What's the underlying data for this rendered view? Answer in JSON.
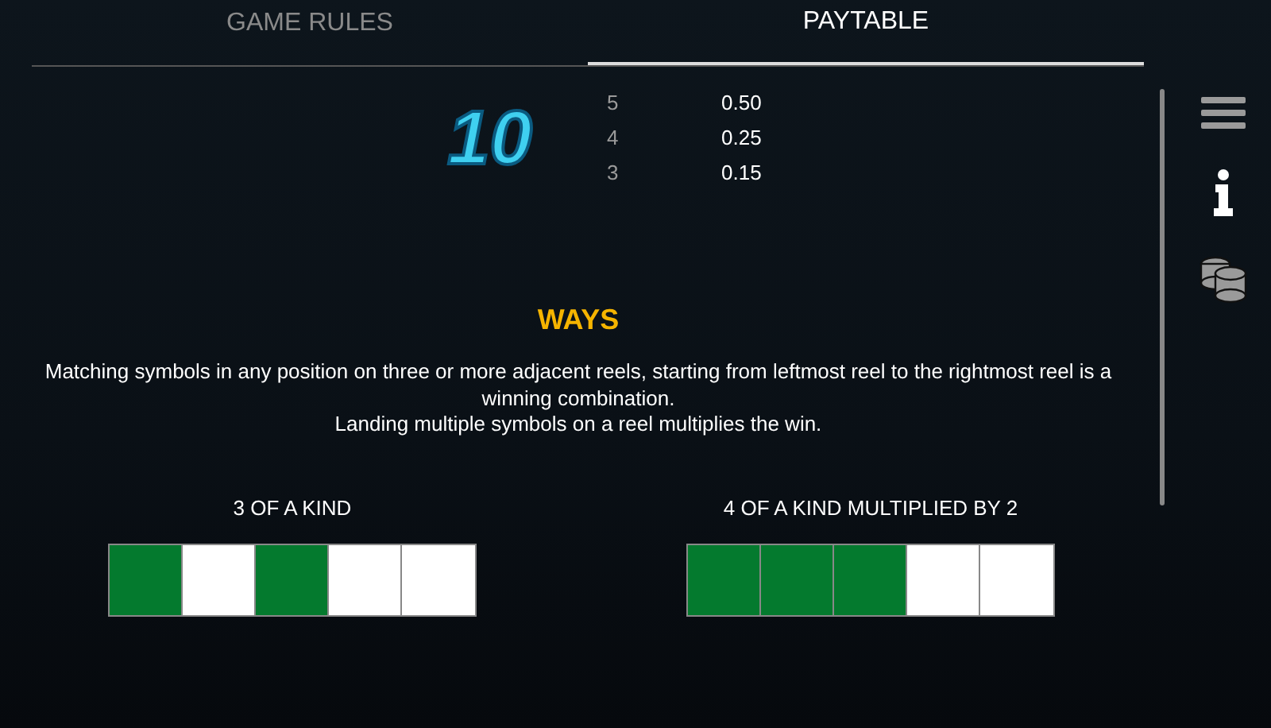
{
  "tabs": [
    {
      "label": "GAME RULES",
      "selected": false
    },
    {
      "label": "PAYTABLE",
      "selected": true
    }
  ],
  "paytable": {
    "symbol": "10",
    "rows": [
      {
        "count": "5",
        "payout": "0.50"
      },
      {
        "count": "4",
        "payout": "0.25"
      },
      {
        "count": "3",
        "payout": "0.15"
      }
    ]
  },
  "ways": {
    "title": "WAYS",
    "lines": [
      "Matching symbols in any position on three or more adjacent reels, starting from leftmost reel to the rightmost reel is a winning combination.",
      "Landing multiple symbols on a reel multiplies the win."
    ],
    "examples": [
      {
        "label": "3 OF A KIND",
        "reels": [
          {
            "highlighted": true
          },
          {
            "highlighted": false
          },
          {
            "highlighted": true
          },
          {
            "highlighted": false
          },
          {
            "highlighted": false
          }
        ]
      },
      {
        "label": "4 OF A KIND MULTIPLIED BY 2",
        "reels": [
          {
            "highlighted": true
          },
          {
            "highlighted": true
          },
          {
            "highlighted": true
          },
          {
            "highlighted": false
          },
          {
            "highlighted": false
          }
        ]
      }
    ]
  },
  "sidebar": [
    {
      "kind": "menu"
    },
    {
      "kind": "info"
    },
    {
      "kind": "coins"
    }
  ]
}
